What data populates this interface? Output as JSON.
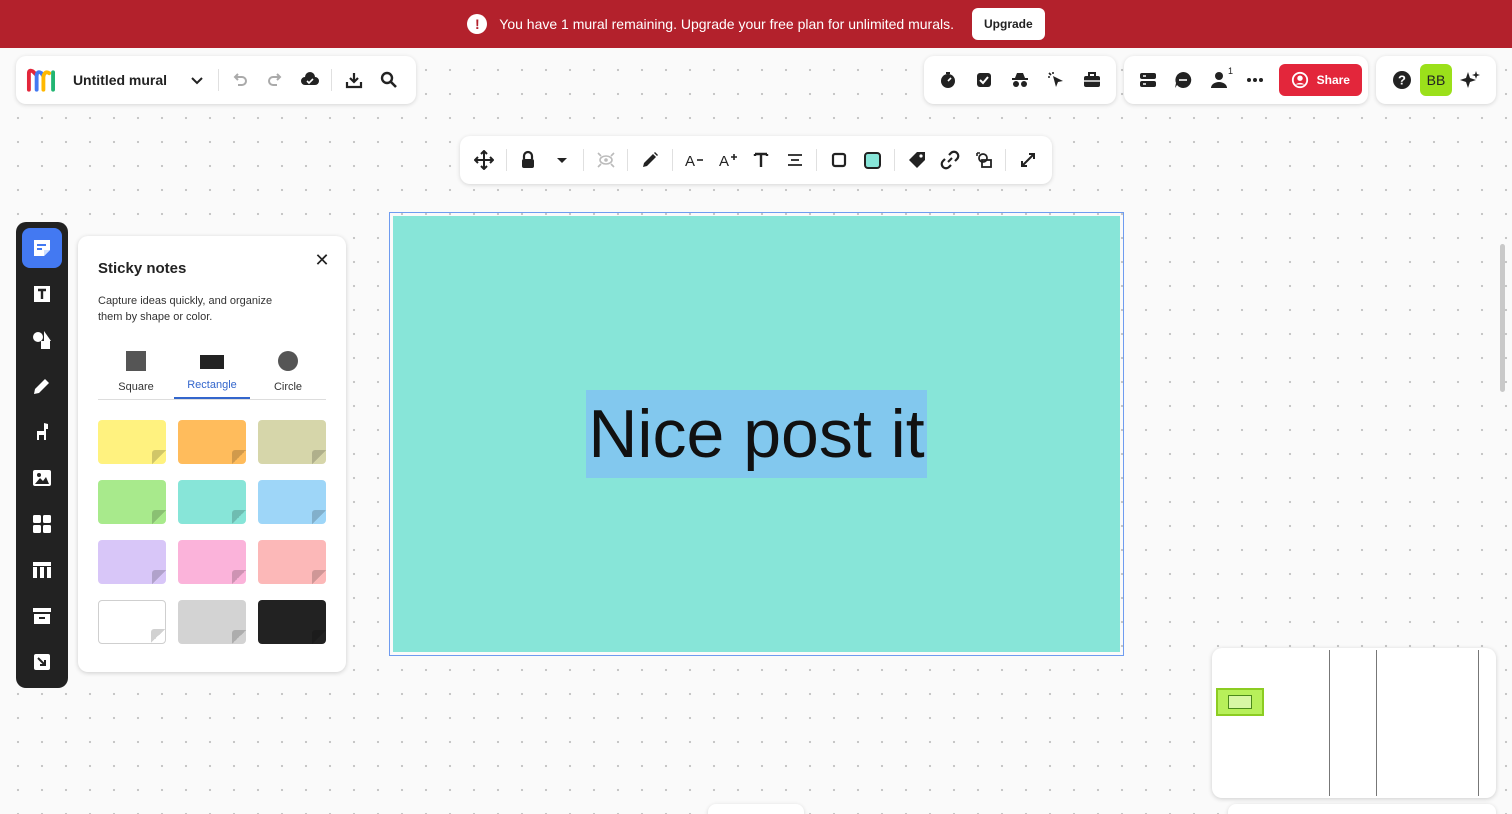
{
  "banner": {
    "message": "You have 1 mural remaining. Upgrade your free plan for unlimited murals.",
    "upgrade_label": "Upgrade",
    "color": "#b3212c"
  },
  "header": {
    "mural_title": "Untitled mural",
    "collaborator_count": "1",
    "share_label": "Share",
    "avatar_initials": "BB",
    "share_color": "#e3263b",
    "avatar_color": "#9be01a"
  },
  "panel": {
    "title": "Sticky notes",
    "description": "Capture ideas quickly, and organize them by shape or color.",
    "shapes": [
      {
        "label": "Square"
      },
      {
        "label": "Rectangle",
        "active": true
      },
      {
        "label": "Circle"
      }
    ],
    "colors": [
      "#fff27f",
      "#ffbc5c",
      "#d6d6aa",
      "#a8ea8c",
      "#87e5d8",
      "#9ed6f8",
      "#d8c6f8",
      "#fbb3da",
      "#fcb8b8",
      "#ffffff",
      "#d3d3d3",
      "#222222"
    ]
  },
  "canvas": {
    "sticky_text": "Nice post it",
    "sticky_color": "#87e5d8",
    "selection_color": "#82c8ee"
  }
}
